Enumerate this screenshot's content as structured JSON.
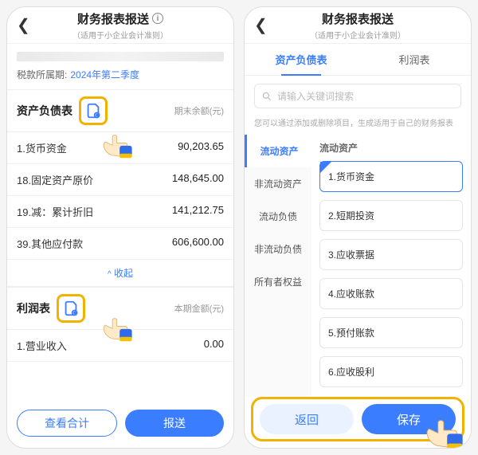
{
  "left": {
    "title": "财务报表报送",
    "subtitle": "（适用于小企业会计准则）",
    "period_label": "税款所属期:",
    "period_value": "2024年第二季度",
    "balance_sheet_title": "资产负债表",
    "balance_col_head": "期末余额(元)",
    "rows": [
      {
        "label": "1.货币资金",
        "value": "90,203.65"
      },
      {
        "label": "18.固定资产原价",
        "value": "148,645.00"
      },
      {
        "label": "19.减：累计折旧",
        "value": "141,212.75"
      },
      {
        "label": "39.其他应付款",
        "value": "606,600.00"
      }
    ],
    "collapse": "收起",
    "profit_title": "利润表",
    "profit_col_head": "本期金额(元)",
    "profit_rows": [
      {
        "label": "1.营业收入",
        "value": "0.00"
      }
    ],
    "btn_view": "查看合计",
    "btn_submit": "报送"
  },
  "right": {
    "title": "财务报表报送",
    "subtitle": "（适用于小企业会计准则）",
    "tabs": {
      "balance": "资产负债表",
      "profit": "利润表"
    },
    "search_placeholder": "请输入关键词搜索",
    "hint": "您可以通过添加或删除项目，生成适用于自己的财务报表",
    "categories": [
      "流动资产",
      "非流动资产",
      "流动负债",
      "非流动负债",
      "所有者权益"
    ],
    "group_title": "流动资产",
    "options": [
      "1.货币资金",
      "2.短期投资",
      "3.应收票据",
      "4.应收账款",
      "5.预付账款",
      "6.应收股利"
    ],
    "btn_back": "返回",
    "btn_save": "保存"
  }
}
